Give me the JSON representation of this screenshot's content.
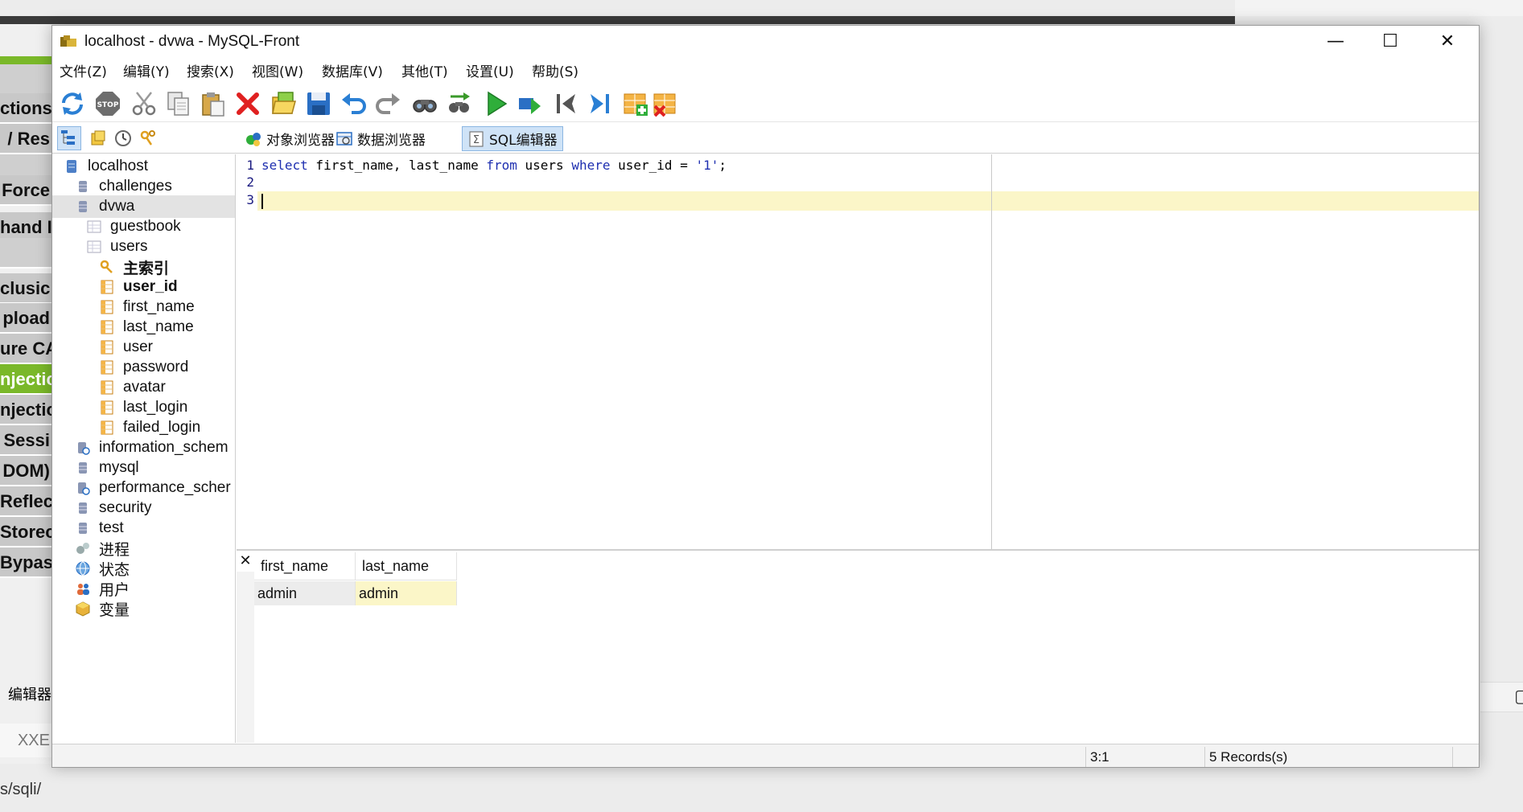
{
  "background_page": {
    "sidebar_items": [
      "ctions",
      "/ Res",
      "",
      "Force",
      "hand I",
      "",
      "clusic",
      "pload",
      "ure CA",
      "njectic",
      "njectic",
      "Sessi",
      "DOM)",
      "Reflec",
      "Storec",
      "Bypass"
    ],
    "label_below": "编辑器",
    "xxe_label": "XXE",
    "url_fragment": "s/sqli/"
  },
  "window": {
    "title": "localhost - dvwa - MySQL-Front",
    "controls": {
      "minimize": "—",
      "maximize": "☐",
      "close": "✕"
    }
  },
  "menu": [
    "文件(Z)",
    "编辑(Y)",
    "搜索(X)",
    "视图(W)",
    "数据库(V)",
    "其他(T)",
    "设置(U)",
    "帮助(S)"
  ],
  "toolbar_icons": [
    "refresh-icon",
    "stop-icon",
    "cut-icon",
    "copy-icon",
    "paste-icon",
    "delete-icon",
    "open-icon",
    "save-icon",
    "undo-icon",
    "redo-icon",
    "find-icon",
    "replace-icon",
    "run-icon",
    "run-line-icon",
    "first-record-icon",
    "last-record-icon",
    "insert-record-icon",
    "delete-record-icon"
  ],
  "view_tabs": [
    {
      "label": "对象浏览器",
      "icon": "object-browser-icon"
    },
    {
      "label": "数据浏览器",
      "icon": "data-browser-icon"
    },
    {
      "label": "SQL编辑器",
      "icon": "sql-editor-icon",
      "active": true
    }
  ],
  "tree": {
    "server": "localhost",
    "databases_before": [
      "challenges",
      "dvwa"
    ],
    "tables": [
      "guestbook",
      "users"
    ],
    "index": "主索引",
    "columns": [
      "user_id",
      "first_name",
      "last_name",
      "user",
      "password",
      "avatar",
      "last_login",
      "failed_login"
    ],
    "databases_after": [
      "information_schem",
      "mysql",
      "performance_scher",
      "security",
      "test"
    ],
    "extras": [
      "进程",
      "状态",
      "用户",
      "变量"
    ]
  },
  "editor": {
    "line_numbers": [
      "1",
      "2",
      "3"
    ],
    "tokens": {
      "select": "select",
      "cols": " first_name, last_name ",
      "from": "from",
      "table": " users ",
      "where": "where",
      "cond": " user_id = ",
      "value": "'1'",
      "end": ";"
    }
  },
  "results": {
    "close": "✕",
    "columns": [
      "first_name",
      "last_name"
    ],
    "rows": [
      [
        "admin",
        "admin"
      ]
    ]
  },
  "status": {
    "position": "3:1",
    "records": "5 Records(s)"
  },
  "colors": {
    "active_tab_bg": "#cfe3f7",
    "current_line": "#fbf6c8",
    "keyword": "#1e2fb0",
    "dvwa_green": "#7ab829"
  }
}
